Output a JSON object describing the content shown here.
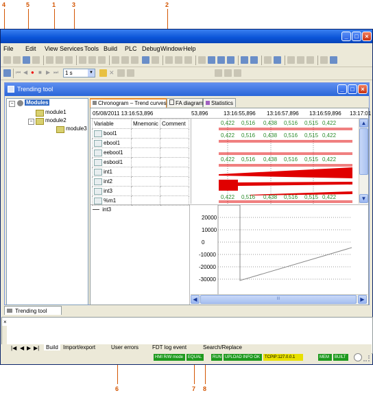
{
  "callouts": [
    "4",
    "5",
    "1",
    "3",
    "2",
    "6",
    "7",
    "8"
  ],
  "menu": [
    "File",
    "Edit",
    "View",
    "Services",
    "Tools",
    "Build",
    "PLC",
    "Debug",
    "Window",
    "Help"
  ],
  "toolbar2": {
    "period": "1 s"
  },
  "trending_window": {
    "title": "Trending tool"
  },
  "tree": {
    "root": "Modules",
    "children": [
      "module1",
      "module2",
      "module3"
    ]
  },
  "tabs": [
    "Chronogram – Trend curves",
    "FA diagram",
    "Statistics"
  ],
  "datetime": "05/08/2011 13:16:53,896",
  "time_axis": [
    "53,896",
    "13:16:55,896",
    "13:16:57,896",
    "13:16:59,896",
    "13:17:01"
  ],
  "columns": [
    "Variable",
    "Mnemonic",
    "Comment"
  ],
  "variables": [
    "bool1",
    "ebool1",
    "eebool1",
    "esbool1",
    "int1",
    "int2",
    "int3",
    "%m1"
  ],
  "chrono_values": [
    [
      "0,422",
      "0,516",
      "0,438",
      "0,516",
      "0,515",
      "0,422"
    ],
    [
      "0,422",
      "0,516",
      "0,438",
      "0,516",
      "0,515",
      "0,422"
    ],
    [
      "0,422",
      "0,516",
      "0,438",
      "0,516",
      "0,515",
      "0,422"
    ],
    [
      "0,422",
      "0,516",
      "0,438",
      "0,516",
      "0,515",
      "0,422"
    ]
  ],
  "curve_var": "int3",
  "y_ticks": [
    "20000",
    "10000",
    "0",
    "-10000",
    "-20000",
    "-30000"
  ],
  "scroll_mid": "III",
  "output_panel": {
    "title": "Trending tool"
  },
  "bottom_tabs": [
    "Build",
    "Import/export",
    "User errors",
    "FDT log event",
    "Search/Replace"
  ],
  "status": [
    "HMI R/W mode",
    "EQUAL",
    "RUN",
    "UPLOAD INFO OK",
    "TCPIP:127.0.0.1",
    "MEM",
    "BUILT"
  ],
  "colors": {
    "accent": "#d35400",
    "curve_green": "#2a8a2a",
    "signal_red": "#e00000",
    "status_green": "#1e9a1e"
  }
}
